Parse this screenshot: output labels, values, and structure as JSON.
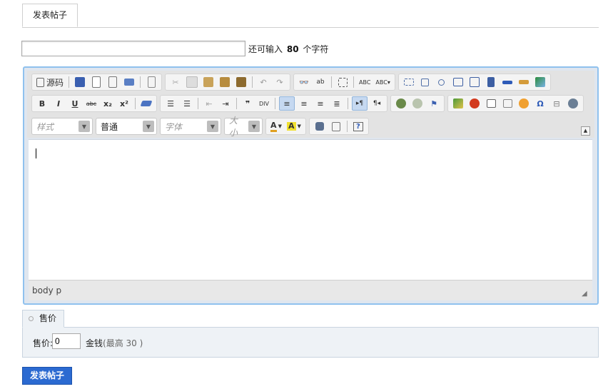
{
  "tab": {
    "label": "发表帖子"
  },
  "title_field": {
    "value": "",
    "counter_prefix": "还可输入",
    "counter_value": "80",
    "counter_suffix": "个字符"
  },
  "toolbar": {
    "row1": [
      {
        "name": "source",
        "icon": "source-icon",
        "label": "源码"
      },
      {
        "name": "save",
        "icon": "save-icon"
      },
      {
        "name": "newpage",
        "icon": "newpage-icon"
      },
      {
        "name": "preview",
        "icon": "preview-icon"
      },
      {
        "name": "print",
        "icon": "print-icon"
      },
      {
        "name": "templates",
        "icon": "templates-icon"
      },
      {
        "name": "cut",
        "icon": "cut-icon"
      },
      {
        "name": "copy",
        "icon": "copy-icon"
      },
      {
        "name": "paste",
        "icon": "paste-icon"
      },
      {
        "name": "paste-text",
        "icon": "paste-text-icon"
      },
      {
        "name": "paste-word",
        "icon": "paste-word-icon"
      },
      {
        "name": "undo",
        "icon": "undo-icon"
      },
      {
        "name": "redo",
        "icon": "redo-icon"
      },
      {
        "name": "find",
        "icon": "find-icon"
      },
      {
        "name": "replace",
        "icon": "replace-icon"
      },
      {
        "name": "select-all",
        "icon": "select-all-icon"
      },
      {
        "name": "spellcheck",
        "icon": "spellcheck-icon"
      },
      {
        "name": "scayt",
        "icon": "scayt-icon"
      },
      {
        "name": "form",
        "icon": "form-icon"
      },
      {
        "name": "checkbox",
        "icon": "checkbox-icon"
      },
      {
        "name": "radio",
        "icon": "radio-icon"
      },
      {
        "name": "textfield",
        "icon": "textfield-icon"
      },
      {
        "name": "textarea",
        "icon": "textarea-icon"
      },
      {
        "name": "select",
        "icon": "select-icon"
      },
      {
        "name": "button",
        "icon": "button-icon"
      },
      {
        "name": "image-button",
        "icon": "image-button-icon"
      },
      {
        "name": "hidden-field",
        "icon": "hidden-field-icon"
      }
    ],
    "row2": [
      {
        "name": "bold",
        "icon": "bold-icon",
        "glyph": "B"
      },
      {
        "name": "italic",
        "icon": "italic-icon",
        "glyph": "I"
      },
      {
        "name": "underline",
        "icon": "underline-icon",
        "glyph": "U"
      },
      {
        "name": "strike",
        "icon": "strikethrough-icon",
        "glyph": "abc"
      },
      {
        "name": "subscript",
        "icon": "subscript-icon",
        "glyph": "x₂"
      },
      {
        "name": "superscript",
        "icon": "superscript-icon",
        "glyph": "x²"
      },
      {
        "name": "remove-format",
        "icon": "eraser-icon"
      }
    ],
    "style_combo": {
      "label": "样式"
    },
    "format_combo": {
      "label": "普通"
    },
    "font_combo": {
      "label": "字体"
    },
    "size_combo": {
      "label": "大小"
    }
  },
  "editor": {
    "status_path": "body p"
  },
  "price_section": {
    "tab_label": "售价",
    "price_label": "售价:",
    "price_value": "0",
    "currency": "金钱",
    "limit": "(最高 30 )"
  },
  "submit": {
    "label": "发表帖子"
  },
  "colors": {
    "accent": "#2b6ad1",
    "editor_border": "#8fc1ee",
    "section_bg": "#eef2f6"
  }
}
